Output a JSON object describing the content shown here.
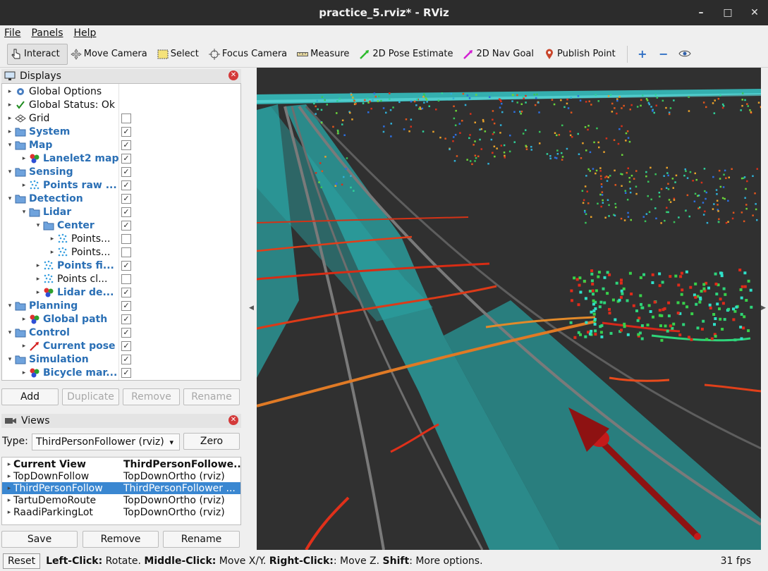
{
  "window": {
    "title": "practice_5.rviz* - RViz",
    "minimize": "–",
    "maximize": "□",
    "close": "✕"
  },
  "menu": [
    "File",
    "Panels",
    "Help"
  ],
  "toolbar": {
    "tools": [
      {
        "label": "Interact",
        "icon": "pointer-hand-icon"
      },
      {
        "label": "Move Camera",
        "icon": "move-camera-icon"
      },
      {
        "label": "Select",
        "icon": "select-rect-icon"
      },
      {
        "label": "Focus Camera",
        "icon": "focus-target-icon"
      },
      {
        "label": "Measure",
        "icon": "ruler-icon"
      },
      {
        "label": "2D Pose Estimate",
        "icon": "green-arrow-icon"
      },
      {
        "label": "2D Nav Goal",
        "icon": "magenta-arrow-icon"
      },
      {
        "label": "Publish Point",
        "icon": "map-pin-icon"
      }
    ],
    "extra": [
      "plus-icon",
      "minus-icon",
      "eye-icon"
    ]
  },
  "displays": {
    "title": "Displays",
    "rows": [
      {
        "label": "Global Options",
        "icon": "gear",
        "blue": false,
        "indent": 0,
        "check": null
      },
      {
        "label": "Global Status: Ok",
        "icon": "checkmark",
        "blue": false,
        "indent": 0,
        "check": null
      },
      {
        "label": "Grid",
        "icon": "grid",
        "blue": false,
        "indent": 0,
        "check": false
      },
      {
        "label": "System",
        "icon": "folder",
        "blue": true,
        "indent": 0,
        "check": true
      },
      {
        "label": "Map",
        "icon": "folder",
        "blue": true,
        "indent": 0,
        "check": true,
        "open": true
      },
      {
        "label": "Lanelet2 map",
        "icon": "marker",
        "blue": true,
        "indent": 1,
        "check": true
      },
      {
        "label": "Sensing",
        "icon": "folder",
        "blue": true,
        "indent": 0,
        "check": true,
        "open": true
      },
      {
        "label": "Points raw ...",
        "icon": "points",
        "blue": true,
        "indent": 1,
        "check": true
      },
      {
        "label": "Detection",
        "icon": "folder",
        "blue": true,
        "indent": 0,
        "check": true,
        "open": true
      },
      {
        "label": "Lidar",
        "icon": "folder",
        "blue": true,
        "indent": 1,
        "check": true,
        "open": true
      },
      {
        "label": "Center",
        "icon": "folder",
        "blue": true,
        "indent": 2,
        "check": true,
        "open": true
      },
      {
        "label": "Points...",
        "icon": "points",
        "blue": false,
        "indent": 3,
        "check": false
      },
      {
        "label": "Points...",
        "icon": "points",
        "blue": false,
        "indent": 3,
        "check": false
      },
      {
        "label": "Points fi...",
        "icon": "points",
        "blue": true,
        "indent": 2,
        "check": true
      },
      {
        "label": "Points cl...",
        "icon": "points",
        "blue": false,
        "indent": 2,
        "check": false
      },
      {
        "label": "Lidar de...",
        "icon": "marker",
        "blue": true,
        "indent": 2,
        "check": true
      },
      {
        "label": "Planning",
        "icon": "folder",
        "blue": true,
        "indent": 0,
        "check": true,
        "open": true
      },
      {
        "label": "Global path",
        "icon": "marker",
        "blue": true,
        "indent": 1,
        "check": true
      },
      {
        "label": "Control",
        "icon": "folder",
        "blue": true,
        "indent": 0,
        "check": true,
        "open": true
      },
      {
        "label": "Current pose",
        "icon": "pose",
        "blue": true,
        "indent": 1,
        "check": true
      },
      {
        "label": "Simulation",
        "icon": "folder",
        "blue": true,
        "indent": 0,
        "check": true,
        "open": true
      },
      {
        "label": "Bicycle mar...",
        "icon": "marker",
        "blue": true,
        "indent": 1,
        "check": true
      }
    ],
    "buttons": {
      "add": "Add",
      "duplicate": "Duplicate",
      "remove": "Remove",
      "rename": "Rename"
    }
  },
  "views": {
    "title": "Views",
    "type_label": "Type:",
    "type_value": "ThirdPersonFollower (rviz)",
    "zero": "Zero",
    "rows": [
      {
        "name": "Current View",
        "type": "ThirdPersonFollowe...",
        "bold": true
      },
      {
        "name": "TopDownFollow",
        "type": "TopDownOrtho (rviz)"
      },
      {
        "name": "ThirdPersonFollow",
        "type": "ThirdPersonFollower ...",
        "selected": true
      },
      {
        "name": "TartuDemoRoute",
        "type": "TopDownOrtho (rviz)"
      },
      {
        "name": "RaadiParkingLot",
        "type": "TopDownOrtho (rviz)"
      }
    ],
    "buttons": {
      "save": "Save",
      "remove": "Remove",
      "rename": "Rename"
    }
  },
  "status": {
    "reset": "Reset",
    "help_parts": [
      {
        "t": "Left-Click:",
        "b": true
      },
      {
        "t": " Rotate. ",
        "b": false
      },
      {
        "t": "Middle-Click:",
        "b": true
      },
      {
        "t": " Move X/Y. ",
        "b": false
      },
      {
        "t": "Right-Click:",
        "b": true
      },
      {
        "t": ": Move Z. ",
        "b": false
      },
      {
        "t": "Shift",
        "b": true
      },
      {
        "t": ": More options.",
        "b": false
      }
    ],
    "fps": "31 fps"
  },
  "colors": {
    "viewport_bg": "#303030",
    "lane": "#2aa8a8",
    "arrow": "#8e1212",
    "selection": "#3a87d1"
  }
}
